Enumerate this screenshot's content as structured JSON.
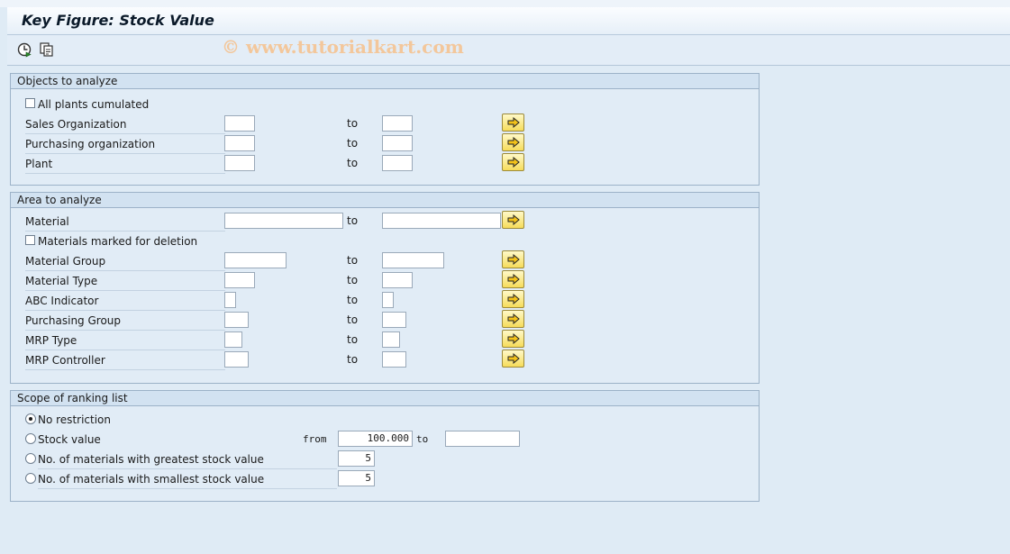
{
  "window": {
    "title": "Key Figure: Stock Value"
  },
  "watermark": "© www.tutorialkart.com",
  "toolbar": {
    "execute_icon": "execute-clock-icon",
    "variant_icon": "get-variant-icon"
  },
  "objects": {
    "header": "Objects to analyze",
    "all_plants_label": "All plants cumulated",
    "to_label": "to",
    "rows": [
      {
        "label": "Sales Organization"
      },
      {
        "label": "Purchasing organization"
      },
      {
        "label": "Plant"
      }
    ]
  },
  "area": {
    "header": "Area to analyze",
    "material_label": "Material",
    "deletion_label": "Materials marked for deletion",
    "to_label": "to",
    "rows": [
      {
        "label": "Material Group"
      },
      {
        "label": "Material Type"
      },
      {
        "label": "ABC Indicator"
      },
      {
        "label": "Purchasing Group"
      },
      {
        "label": "MRP Type"
      },
      {
        "label": "MRP Controller"
      }
    ]
  },
  "scope": {
    "header": "Scope of ranking list",
    "no_restriction": "No restriction",
    "stock_value": "Stock value",
    "from_label": "from",
    "to_label": "to",
    "from_value": "100.000",
    "greatest_label": "No. of materials with greatest stock value",
    "greatest_value": "5",
    "smallest_label": "No. of materials with smallest stock value",
    "smallest_value": "5"
  },
  "colors": {
    "background": "#dfebf5",
    "multi_button": "#f6dc5a"
  }
}
